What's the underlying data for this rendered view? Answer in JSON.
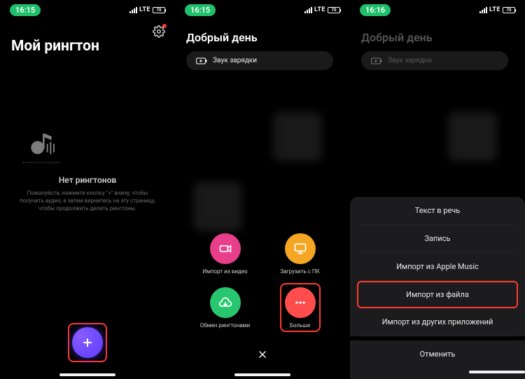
{
  "colors": {
    "accent_purple": "#6b46ff",
    "highlight_red": "#ff3b30",
    "action_pink": "#e83e8c",
    "action_orange": "#f5a623",
    "action_green": "#28c76f",
    "action_red": "#ff4d4d"
  },
  "screen1": {
    "status": {
      "time": "16:15",
      "net": "LTE",
      "battery": "70"
    },
    "title": "Мой рингтон",
    "empty_title": "Нет рингтонов",
    "empty_desc": "Пожалуйста, нажмите кнопку \"+\" внизу, чтобы получить аудио, а затем вернитесь на эту страницу, чтобы продолжить делать рингтоны.",
    "icons": {
      "settings": "gear-icon",
      "music": "music-note-icon",
      "add": "plus-icon"
    }
  },
  "screen2": {
    "status": {
      "time": "16:15",
      "net": "LTE",
      "battery": "70"
    },
    "greeting": "Добрый день",
    "pill_label": "Звук зарядки",
    "actions": [
      {
        "key": "import_video",
        "label": "Импорт из видео",
        "icon": "camera-icon",
        "color": "pink"
      },
      {
        "key": "download_pc",
        "label": "Загрузить с ПК",
        "icon": "monitor-icon",
        "color": "orange"
      },
      {
        "key": "share_ringtones",
        "label": "Обмен рингтонами",
        "icon": "cloud-download-icon",
        "color": "green"
      },
      {
        "key": "more",
        "label": "Больше",
        "icon": "dots-icon",
        "color": "red"
      }
    ],
    "close_icon": "close-icon"
  },
  "screen3": {
    "status": {
      "time": "16:16",
      "net": "LTE",
      "battery": "70"
    },
    "greeting": "Добрый день",
    "pill_label": "Звук зарядки",
    "sheet": {
      "items": [
        {
          "key": "tts",
          "label": "Текст в речь"
        },
        {
          "key": "record",
          "label": "Запись"
        },
        {
          "key": "apple_music",
          "label": "Импорт из Apple Music"
        },
        {
          "key": "file",
          "label": "Импорт из файла",
          "highlighted": true
        },
        {
          "key": "other_apps",
          "label": "Импорт из других приложений"
        }
      ],
      "cancel": "Отменить"
    }
  }
}
